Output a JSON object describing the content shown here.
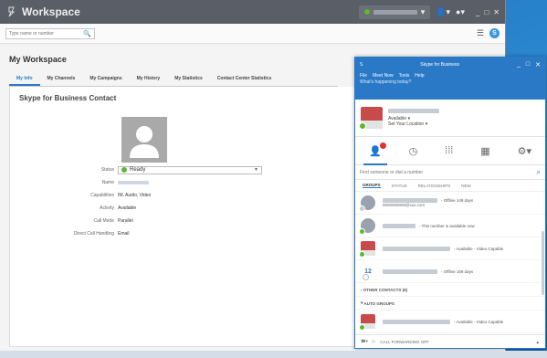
{
  "window": {
    "title": "Workspace",
    "toolbar_icon_user": "user-icon",
    "toolbar_icon_help": "help-icon"
  },
  "search": {
    "placeholder": "Type name or number"
  },
  "page": {
    "heading": "My Workspace",
    "tabs": [
      "My Info",
      "My Channels",
      "My Campaigns",
      "My History",
      "My Statistics",
      "Contact Center Statistics"
    ],
    "panel_title": "Skype for Business Contact",
    "fields": {
      "status_label": "Status",
      "status_value": "Ready",
      "name_label": "Name",
      "capabilities_label": "Capabilities",
      "capabilities_value": "IM, Audio, Video",
      "activity_label": "Activity",
      "activity_value": "Available",
      "call_mode_label": "Call Mode",
      "call_mode_value": "Parallel",
      "direct_call_label": "Direct Call Handling",
      "direct_call_value": "Email"
    }
  },
  "skype": {
    "title": "Skype for Business",
    "menu": [
      "File",
      "Meet Now",
      "Tools",
      "Help"
    ],
    "whats_happening": "What's happening today?",
    "me_status": "Available",
    "me_location": "Set Your Location",
    "search_placeholder": "Find someone or dial a number",
    "group_tabs": [
      "GROUPS",
      "STATUS",
      "RELATIONSHIPS",
      "NEW"
    ],
    "contacts": [
      {
        "status": "- Offline 149 days",
        "sub": "0000000000@xxx.com"
      },
      {
        "status": "- This number is available now"
      },
      {
        "status": "- Available - Video Capable"
      },
      {
        "number": "12",
        "status": "- Offline 159 days"
      }
    ],
    "other_contacts": "OTHER CONTACTS (6)",
    "auto_groups": "AUTO GROUPS",
    "auto_contact_status": "- Available - Video Capable",
    "call_forwarding": "CALL FORWARDING OFF"
  },
  "colors": {
    "accent": "#2a79c7",
    "title_bar": "#5a5e66",
    "presence_green": "#5cb82c",
    "badge_red": "#e0322f"
  }
}
